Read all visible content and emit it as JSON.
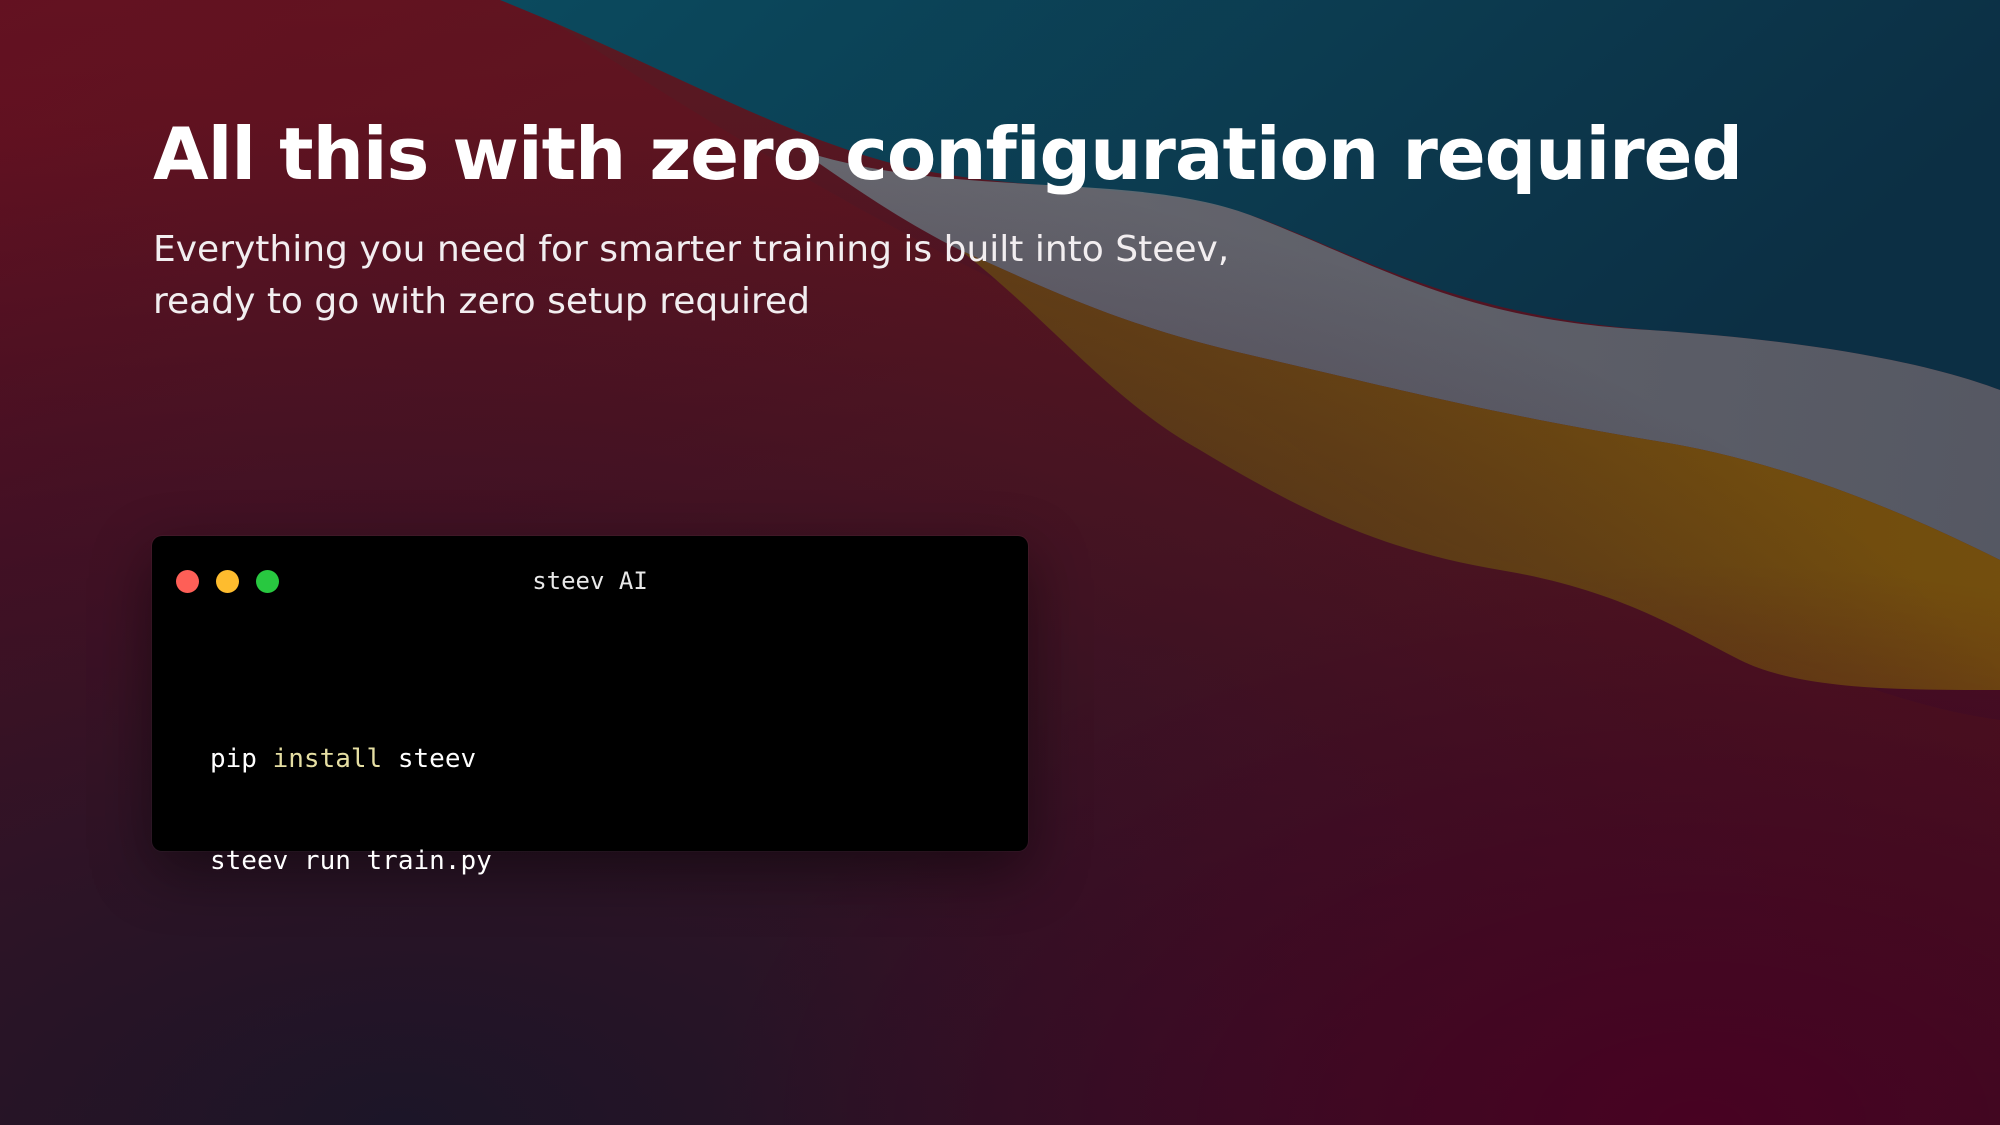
{
  "hero": {
    "title": "All this with zero configuration required",
    "subtitle_line1": "Everything you need for smarter training is built into Steev,",
    "subtitle_line2": "ready to go with zero setup required"
  },
  "terminal": {
    "title": "steev AI",
    "window_controls": [
      "close",
      "minimize",
      "maximize"
    ],
    "lines": [
      {
        "cmd": "pip",
        "keyword": "install",
        "arg": "steev"
      },
      {
        "text": "steev run train.py"
      }
    ]
  },
  "colors": {
    "background_wallpaper": "macOS Big Sur style gradient",
    "terminal_bg": "#000000",
    "keyword": "#e6dfa3",
    "close": "#fe5f57",
    "minimize": "#febc2e",
    "maximize": "#28c840"
  }
}
